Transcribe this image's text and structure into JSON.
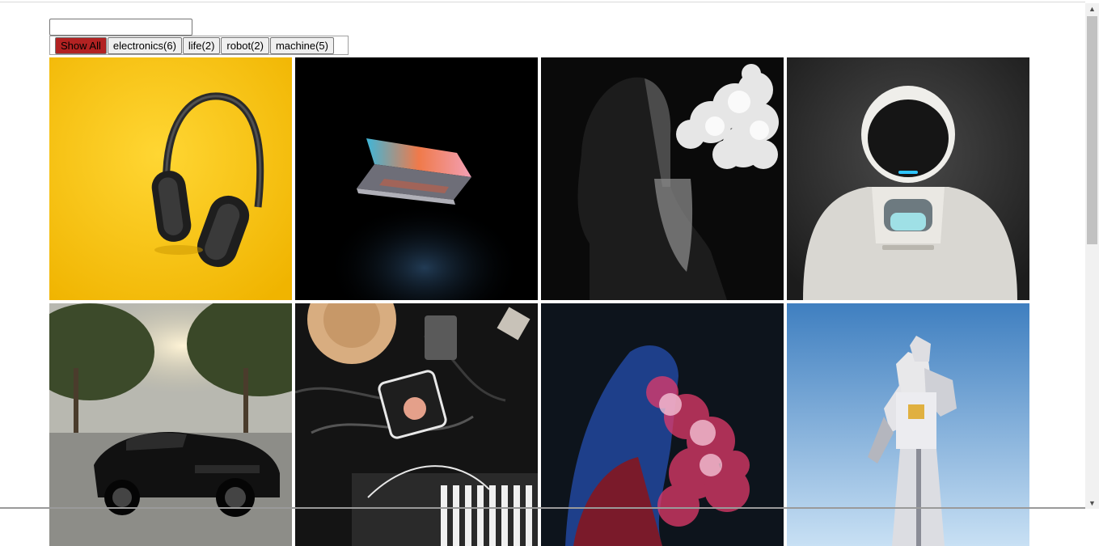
{
  "search": {
    "value": "",
    "placeholder": ""
  },
  "filters": [
    {
      "label": "Show All",
      "active": true
    },
    {
      "label": "electronics(6)",
      "active": false
    },
    {
      "label": "life(2)",
      "active": false
    },
    {
      "label": "robot(2)",
      "active": false
    },
    {
      "label": "machine(5)",
      "active": false
    }
  ],
  "colors": {
    "active_filter": "#b22222",
    "page_background": "#ffffff"
  },
  "gallery": [
    {
      "subject": "headphones-on-yellow"
    },
    {
      "subject": "laptop-in-dark"
    },
    {
      "subject": "man-exhaling-smoke"
    },
    {
      "subject": "white-humanoid-robot"
    },
    {
      "subject": "black-sports-car"
    },
    {
      "subject": "audio-gear-and-cables"
    },
    {
      "subject": "person-with-red-smoke"
    },
    {
      "subject": "giant-robot-statue"
    }
  ]
}
